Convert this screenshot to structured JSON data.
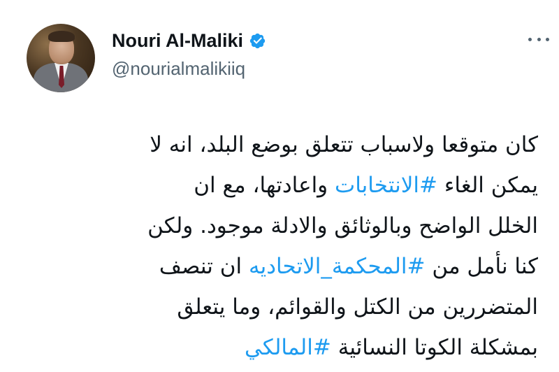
{
  "tweet": {
    "author": {
      "display_name": "Nouri Al-Maliki",
      "handle": "@nourialmalikiiq",
      "verified": true,
      "verified_icon": "verified-badge-icon",
      "avatar": "profile-photo"
    },
    "more_icon": "more-horizontal-icon",
    "hashtag_color": "#1d9bf0",
    "lines": [
      {
        "parts": [
          {
            "text": "كان متوقعا ولاسباب تتعلق بوضع البلد، انه لا"
          }
        ]
      },
      {
        "parts": [
          {
            "text": "يمكن الغاء "
          },
          {
            "text": "#الانتخابات",
            "hashtag": true
          },
          {
            "text": " واعادتها، مع ان"
          }
        ]
      },
      {
        "parts": [
          {
            "text": "الخلل الواضح وبالوثائق والادلة موجود. ولكن"
          }
        ]
      },
      {
        "parts": [
          {
            "text": "كنا نأمل من "
          },
          {
            "text": "#المحكمة_الاتحاديه",
            "hashtag": true
          },
          {
            "text": " ان تنصف"
          }
        ]
      },
      {
        "parts": [
          {
            "text": "المتضررين من الكتل والقوائم، وما يتعلق"
          }
        ]
      },
      {
        "parts": [
          {
            "text": "بمشكلة الكوتا النسائية "
          },
          {
            "text": "#المالكي",
            "hashtag": true
          }
        ]
      }
    ]
  }
}
